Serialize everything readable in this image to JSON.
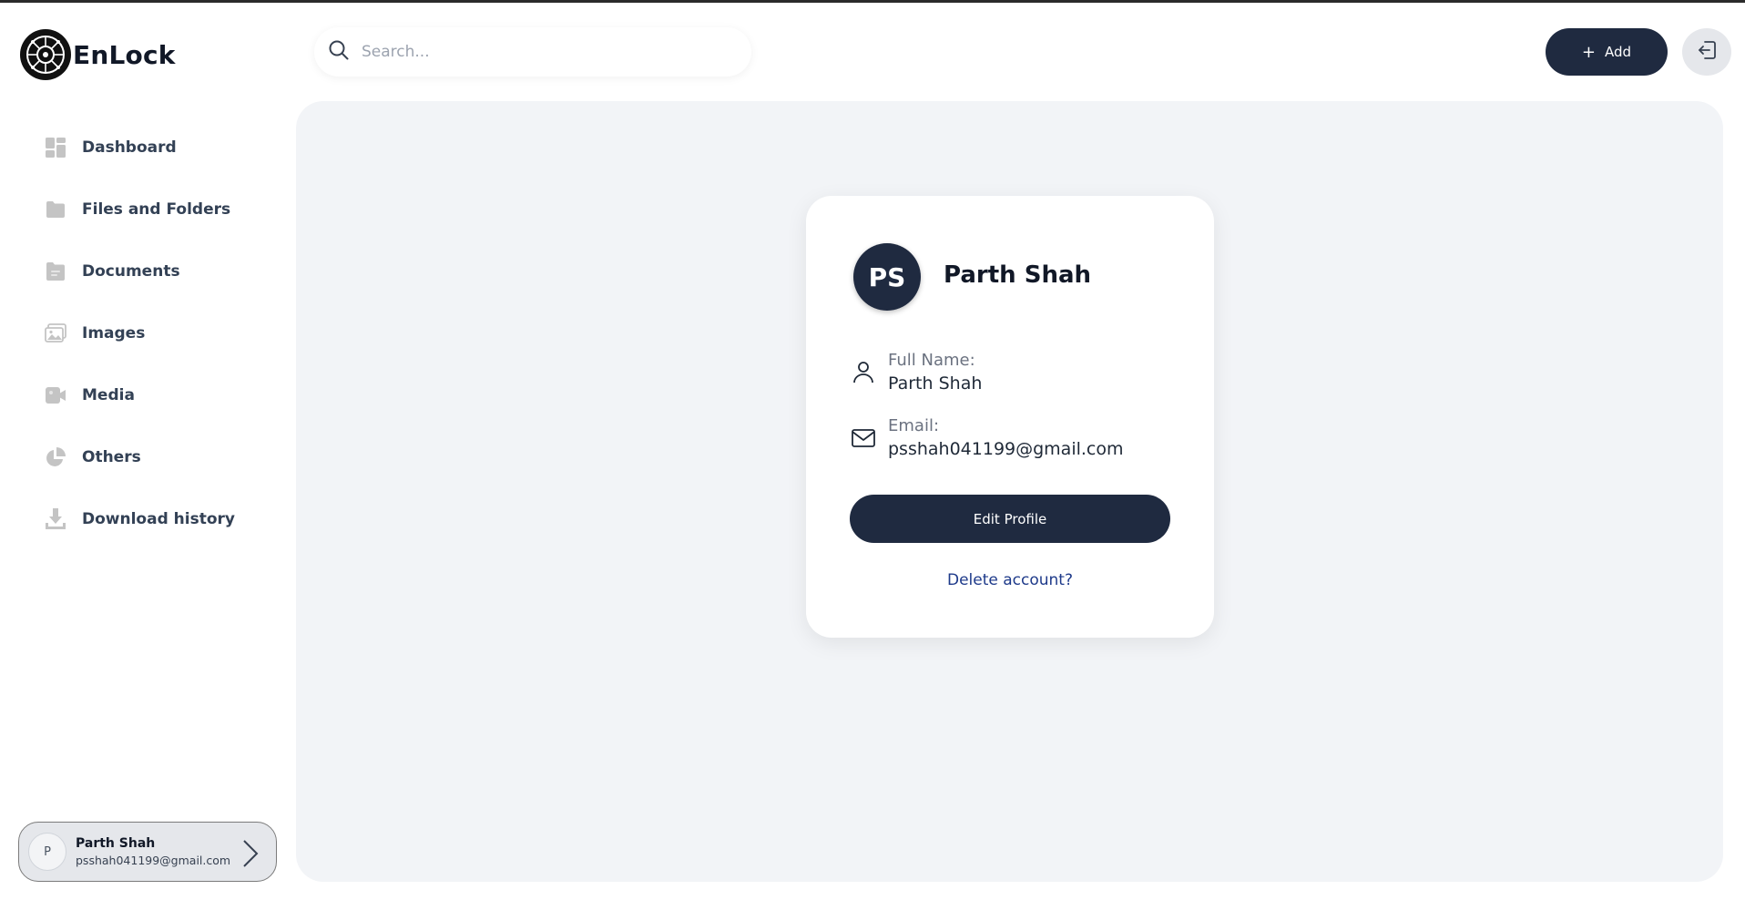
{
  "app": {
    "name": "EnLock"
  },
  "search": {
    "placeholder": "Search..."
  },
  "header": {
    "add_label": "Add"
  },
  "sidebar": {
    "items": [
      {
        "label": "Dashboard",
        "icon": "dashboard-icon"
      },
      {
        "label": "Files and Folders",
        "icon": "folder-icon"
      },
      {
        "label": "Documents",
        "icon": "document-icon"
      },
      {
        "label": "Images",
        "icon": "image-icon"
      },
      {
        "label": "Media",
        "icon": "video-icon"
      },
      {
        "label": "Others",
        "icon": "pie-chart-icon"
      },
      {
        "label": "Download history",
        "icon": "download-icon"
      }
    ],
    "user": {
      "initial": "P",
      "name": "Parth Shah",
      "email": "psshah041199@gmail.com"
    }
  },
  "profile": {
    "initials": "PS",
    "name": "Parth Shah",
    "full_name_label": "Full Name:",
    "full_name_value": "Parth Shah",
    "email_label": "Email:",
    "email_value": "psshah041199@gmail.com",
    "edit_button": "Edit Profile",
    "delete_link": "Delete account?"
  },
  "colors": {
    "primary": "#1f2a40",
    "background": "#f2f4f7",
    "link": "#1e3a8a"
  }
}
